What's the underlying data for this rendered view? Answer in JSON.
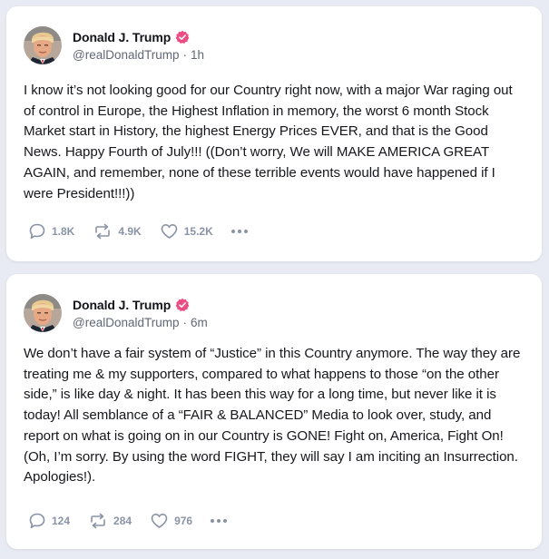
{
  "colors": {
    "page_background": "#e8ebf3",
    "verified_badge": "#ec4d82",
    "action_gray": "#8a93a5",
    "handle_gray": "#606775"
  },
  "posts": [
    {
      "author_name": "Donald J. Trump",
      "handle": "@realDonaldTrump",
      "time": "1h",
      "text": "I know it’s not looking good for our Country right now, with a major War raging out of control in Europe, the Highest Inflation in memory, the worst 6 month Stock Market start in History, the highest Energy Prices EVER, and that is the Good News. Happy Fourth of July!!! ((Don’t worry, We will MAKE AMERICA GREAT AGAIN, and remember, none of these terrible events would have happened if I were President!!!))",
      "replies": "1.8K",
      "reposts": "4.9K",
      "likes": "15.2K"
    },
    {
      "author_name": "Donald J. Trump",
      "handle": "@realDonaldTrump",
      "time": "6m",
      "text": "We don’t have a fair system of “Justice” in this Country anymore. The way they are treating me & my supporters, compared to what happens to those “on the other side,” is like day & night. It has been this way for a long time, but never like it is today! All semblance of a “FAIR & BALANCED” Media to look over, study, and report on what is going on in our Country is GONE! Fight on, America, Fight On! (Oh, I’m sorry. By using the word FIGHT, they will say I am inciting an Insurrection. Apologies!).",
      "replies": "124",
      "reposts": "284",
      "likes": "976"
    }
  ],
  "icons": {
    "reply": "speech-bubble-icon",
    "repost": "repost-arrows-icon",
    "like": "heart-icon",
    "more": "ellipsis-icon",
    "verified": "verified-badge-icon"
  }
}
